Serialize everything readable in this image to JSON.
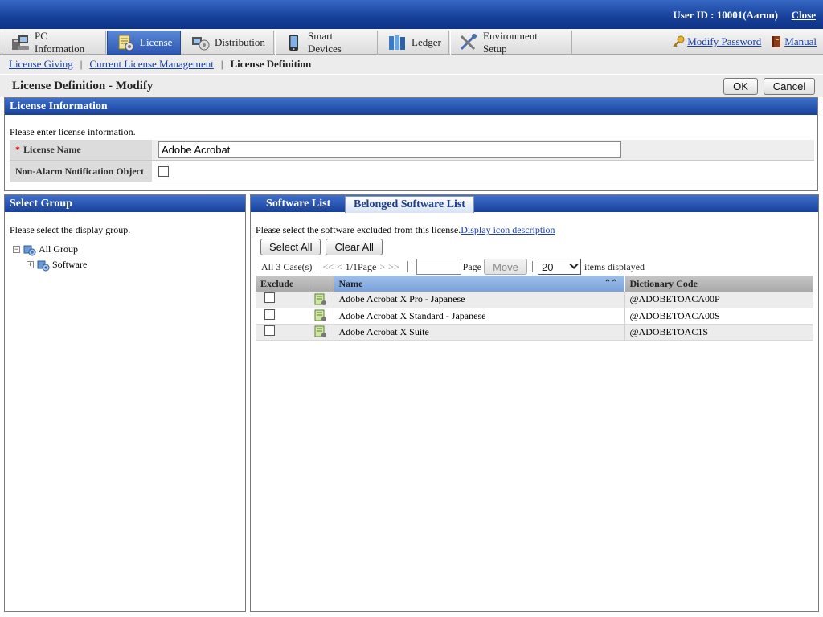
{
  "header": {
    "user_label": "User ID : ",
    "user_value": "10001(Aaron)",
    "close_label": "Close"
  },
  "tabs": [
    {
      "label": "PC Information",
      "icon": "pc-icon"
    },
    {
      "label": "License",
      "icon": "license-icon",
      "active": true
    },
    {
      "label": "Distribution",
      "icon": "distribution-icon"
    },
    {
      "label": "Smart Devices",
      "icon": "phone-icon"
    },
    {
      "label": "Ledger",
      "icon": "ledger-icon"
    },
    {
      "label": "Environment Setup",
      "icon": "tools-icon"
    }
  ],
  "top_links": {
    "modify_password": "Modify Password",
    "manual": "Manual"
  },
  "breadcrumb": {
    "item1": "License Giving",
    "item2": "Current License Management",
    "current": "License Definition"
  },
  "page": {
    "title": "License Definition - Modify",
    "ok_label": "OK",
    "cancel_label": "Cancel"
  },
  "license_info": {
    "heading": "License Information",
    "hint": "Please enter license information.",
    "required_mark": "*",
    "name_label": "License Name",
    "name_value": "Adobe Acrobat",
    "non_alarm_label": "Non-Alarm Notification Object",
    "non_alarm_checked": false
  },
  "select_group": {
    "heading": "Select Group",
    "hint": "Please select the display group.",
    "tree": {
      "root": "All Group",
      "child": "Software",
      "root_toggle": "−",
      "child_toggle": "+"
    }
  },
  "software_panel": {
    "tab1": "Software List",
    "tab2": "Belonged Software List",
    "hint": "Please select the software excluded from this license.",
    "icon_link": "Display icon description",
    "select_all": "Select All",
    "clear_all": "Clear All",
    "pager": {
      "count": "All 3 Case(s)",
      "first": "<<",
      "prev": "<",
      "page_info": "1/1Page",
      "next": ">",
      "last": ">>",
      "page_label": "Page",
      "move": "Move",
      "per_page": "20",
      "items_label": "items displayed"
    },
    "columns": {
      "exclude": "Exclude",
      "name": "Name",
      "code": "Dictionary Code"
    },
    "rows": [
      {
        "name": "Adobe Acrobat X Pro - Japanese",
        "code": "@ADOBETOACA00P"
      },
      {
        "name": "Adobe Acrobat X Standard - Japanese",
        "code": "@ADOBETOACA00S"
      },
      {
        "name": "Adobe Acrobat X Suite",
        "code": "@ADOBETOAC1S"
      }
    ]
  },
  "colors": {
    "header_blue": "#17409a",
    "active_tab": "#2c58b3",
    "link": "#1a3fa8",
    "required": "#d40000"
  }
}
